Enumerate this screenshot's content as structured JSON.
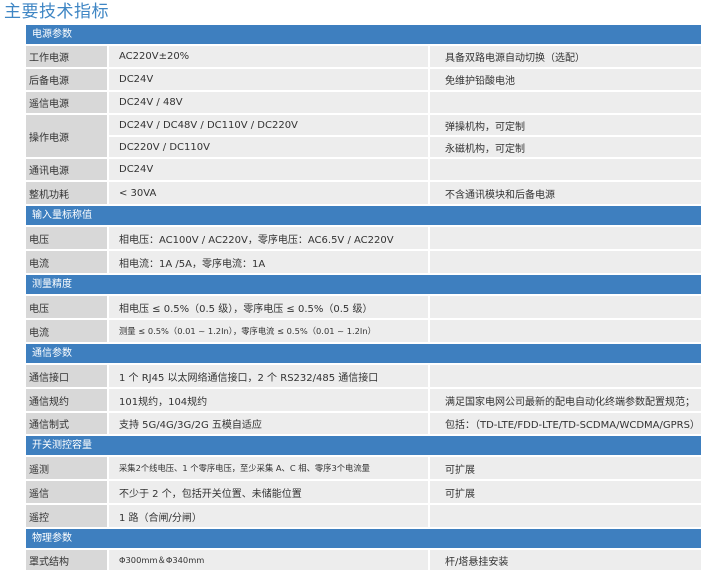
{
  "title": "主要技术指标",
  "colors": {
    "title": "#3f86c4",
    "section_bg": "#3e7fbf",
    "label_bg": "#d8d8d8",
    "cell_bg": "#ededed"
  },
  "sections": [
    {
      "title": "电源参数",
      "rows": [
        {
          "label": "工作电源",
          "values": [
            "AC220V±20%"
          ],
          "notes": [
            "具备双路电源自动切换（选配）"
          ]
        },
        {
          "label": "后备电源",
          "values": [
            "DC24V"
          ],
          "notes": [
            "免维护铅酸电池"
          ]
        },
        {
          "label": "遥信电源",
          "values": [
            "DC24V / 48V"
          ],
          "notes": [
            ""
          ]
        },
        {
          "label": "操作电源",
          "values": [
            "DC24V / DC48V / DC110V / DC220V",
            "DC220V / DC110V"
          ],
          "notes": [
            "弹操机构，可定制",
            "永磁机构，可定制"
          ]
        },
        {
          "label": "通讯电源",
          "values": [
            "DC24V"
          ],
          "notes": [
            ""
          ]
        },
        {
          "label": "整机功耗",
          "values": [
            "< 30VA"
          ],
          "notes": [
            "不含通讯模块和后备电源"
          ]
        }
      ]
    },
    {
      "title": "输入量标称值",
      "rows": [
        {
          "label": "电压",
          "values": [
            "相电压：AC100V / AC220V，零序电压：AC6.5V / AC220V"
          ],
          "notes": [
            ""
          ]
        },
        {
          "label": "电流",
          "values": [
            "相电流：1A /5A，零序电流：1A"
          ],
          "notes": [
            ""
          ]
        }
      ]
    },
    {
      "title": "测量精度",
      "rows": [
        {
          "label": "电压",
          "values": [
            "相电压 ≤ 0.5%（0.5 级），零序电压 ≤ 0.5%（0.5 级）"
          ],
          "notes": [
            ""
          ]
        },
        {
          "label": "电流",
          "values": [
            "测量 ≤ 0.5%（0.01 ~ 1.2In），零序电流 ≤ 0.5%（0.01 ~ 1.2In）"
          ],
          "notes": [
            ""
          ],
          "small": true
        }
      ]
    },
    {
      "title": "通信参数",
      "rows": [
        {
          "label": "通信接口",
          "values": [
            "1 个 RJ45 以太网络通信接口，2 个 RS232/485 通信接口"
          ],
          "notes": [
            ""
          ]
        },
        {
          "label": "通信规约",
          "values": [
            "101规约，104规约"
          ],
          "notes": [
            "满足国家电网公司最新的配电自动化终端参数配置规范；"
          ]
        },
        {
          "label": "通信制式",
          "values": [
            "支持 5G/4G/3G/2G 五模自适应"
          ],
          "notes": [
            "包括：（TD-LTE/FDD-LTE/TD-SCDMA/WCDMA/GPRS）"
          ]
        }
      ]
    },
    {
      "title": "开关测控容量",
      "rows": [
        {
          "label": "遥测",
          "values": [
            "采集2个线电压、1 个零序电压，至少采集 A、C 相、零序3个电流量"
          ],
          "notes": [
            "可扩展"
          ],
          "small": true
        },
        {
          "label": "遥信",
          "values": [
            "不少于 2 个，包括开关位置、未储能位置"
          ],
          "notes": [
            "可扩展"
          ]
        },
        {
          "label": "遥控",
          "values": [
            "1 路（合闸/分闸）"
          ],
          "notes": [
            ""
          ]
        }
      ]
    },
    {
      "title": "物理参数",
      "rows": [
        {
          "label": "罩式结构",
          "values": [
            "Φ300mm＆Φ340mm"
          ],
          "notes": [
            "杆/塔悬挂安装"
          ],
          "small": true
        }
      ]
    }
  ]
}
